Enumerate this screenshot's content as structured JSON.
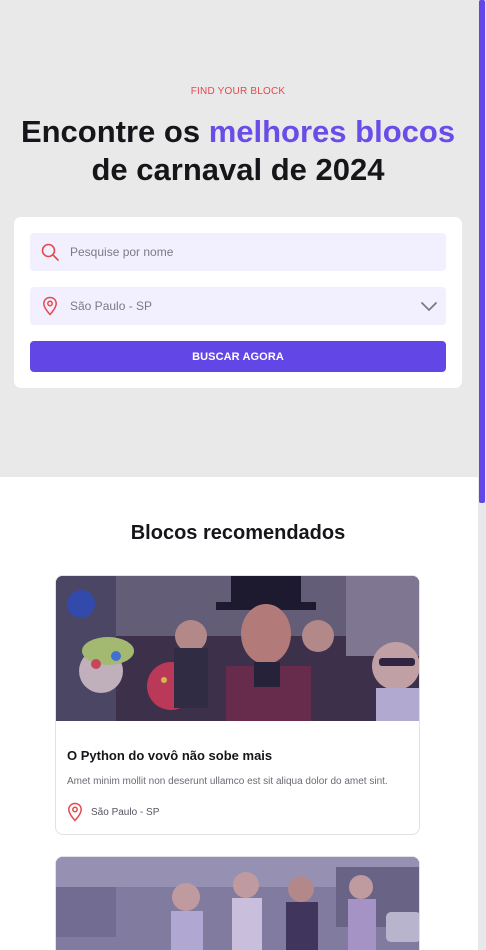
{
  "hero": {
    "eyebrow": "FIND YOUR BLOCK",
    "headline_part1": "Encontre os ",
    "headline_accent": "melhores blocos",
    "headline_part2": "de carnaval de 2024"
  },
  "search": {
    "name_placeholder": "Pesquise por nome",
    "location_value": "São Paulo - SP",
    "button_label": "BUSCAR AGORA"
  },
  "recommended": {
    "title": "Blocos recomendados",
    "cards": [
      {
        "title": "O Python do vovô não sobe mais",
        "description": "Amet minim mollit non deserunt ullamco est sit aliqua dolor do amet sint.",
        "location": "São Paulo - SP"
      }
    ]
  },
  "colors": {
    "accent": "#6347e6",
    "eyebrow": "#e5484d",
    "hero_bg": "#e9e9ea",
    "field_bg": "#f2f0fe"
  },
  "icons": [
    "search-icon",
    "map-pin-icon",
    "chevron-down-icon"
  ]
}
